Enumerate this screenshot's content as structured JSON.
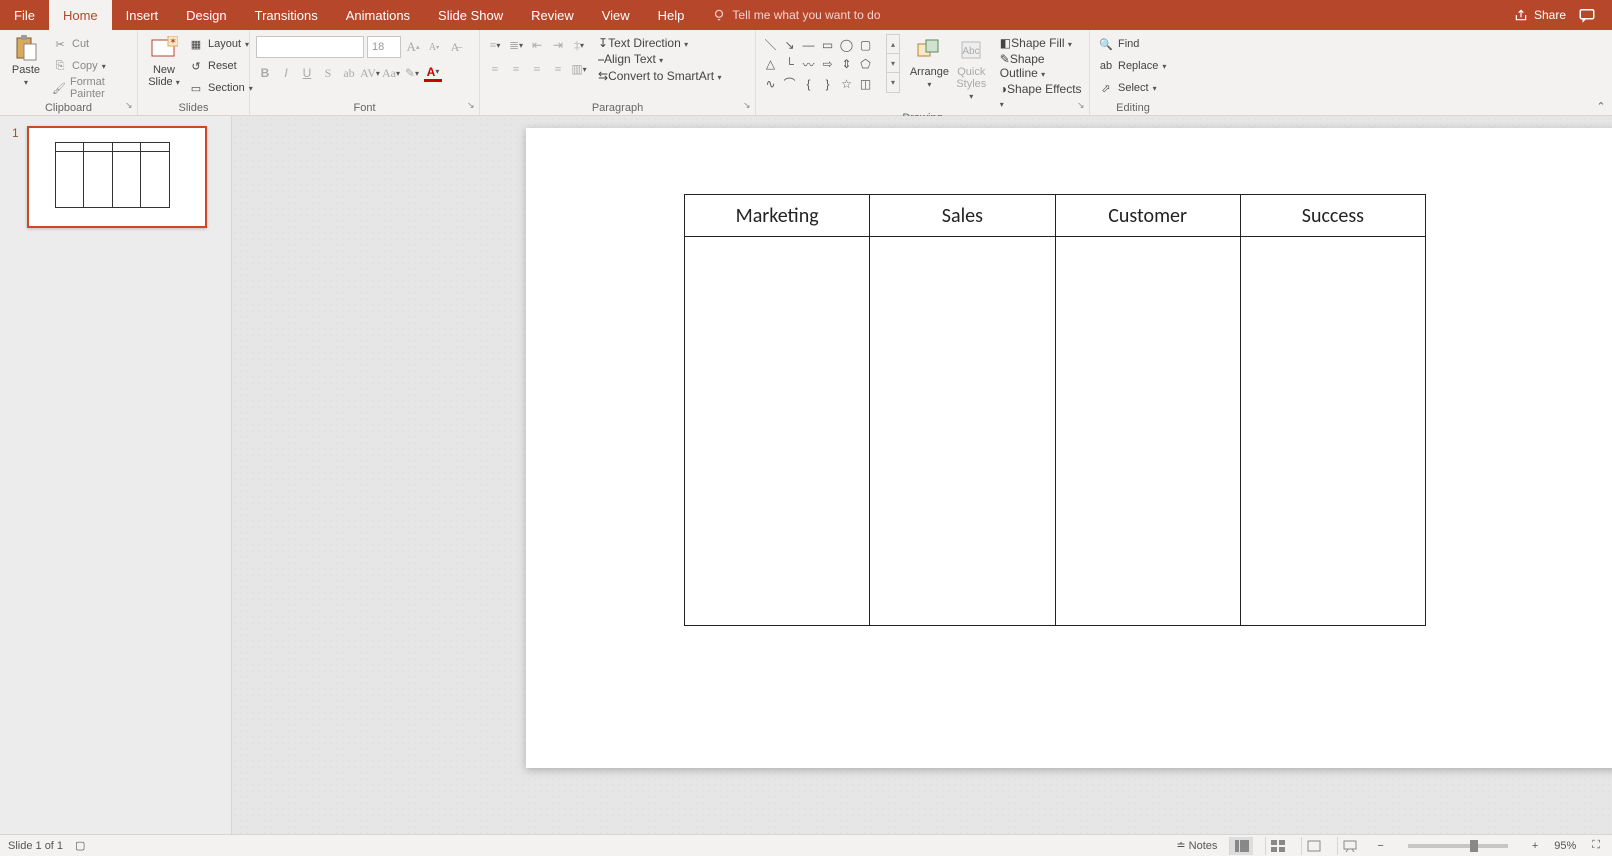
{
  "tabs": {
    "file": "File",
    "home": "Home",
    "insert": "Insert",
    "design": "Design",
    "transitions": "Transitions",
    "animations": "Animations",
    "slideshow": "Slide Show",
    "review": "Review",
    "view": "View",
    "help": "Help",
    "tellme": "Tell me what you want to do",
    "share": "Share"
  },
  "ribbon": {
    "clipboard": {
      "paste": "Paste",
      "cut": "Cut",
      "copy": "Copy",
      "format_painter": "Format Painter",
      "label": "Clipboard"
    },
    "slides": {
      "new_slide": "New\nSlide",
      "layout": "Layout",
      "reset": "Reset",
      "section": "Section",
      "label": "Slides"
    },
    "font": {
      "size": "18",
      "label": "Font"
    },
    "paragraph": {
      "text_direction": "Text Direction",
      "align_text": "Align Text",
      "smartart": "Convert to SmartArt",
      "label": "Paragraph"
    },
    "drawing": {
      "arrange": "Arrange",
      "quick_styles": "Quick\nStyles",
      "shape_fill": "Shape Fill",
      "shape_outline": "Shape Outline",
      "shape_effects": "Shape Effects",
      "label": "Drawing"
    },
    "editing": {
      "find": "Find",
      "replace": "Replace",
      "select": "Select",
      "label": "Editing"
    }
  },
  "slide": {
    "number": "1",
    "table_headers": [
      "Marketing",
      "Sales",
      "Customer",
      "Success"
    ]
  },
  "status": {
    "slide_of": "Slide 1 of 1",
    "notes": "Notes",
    "zoom": "95%"
  }
}
